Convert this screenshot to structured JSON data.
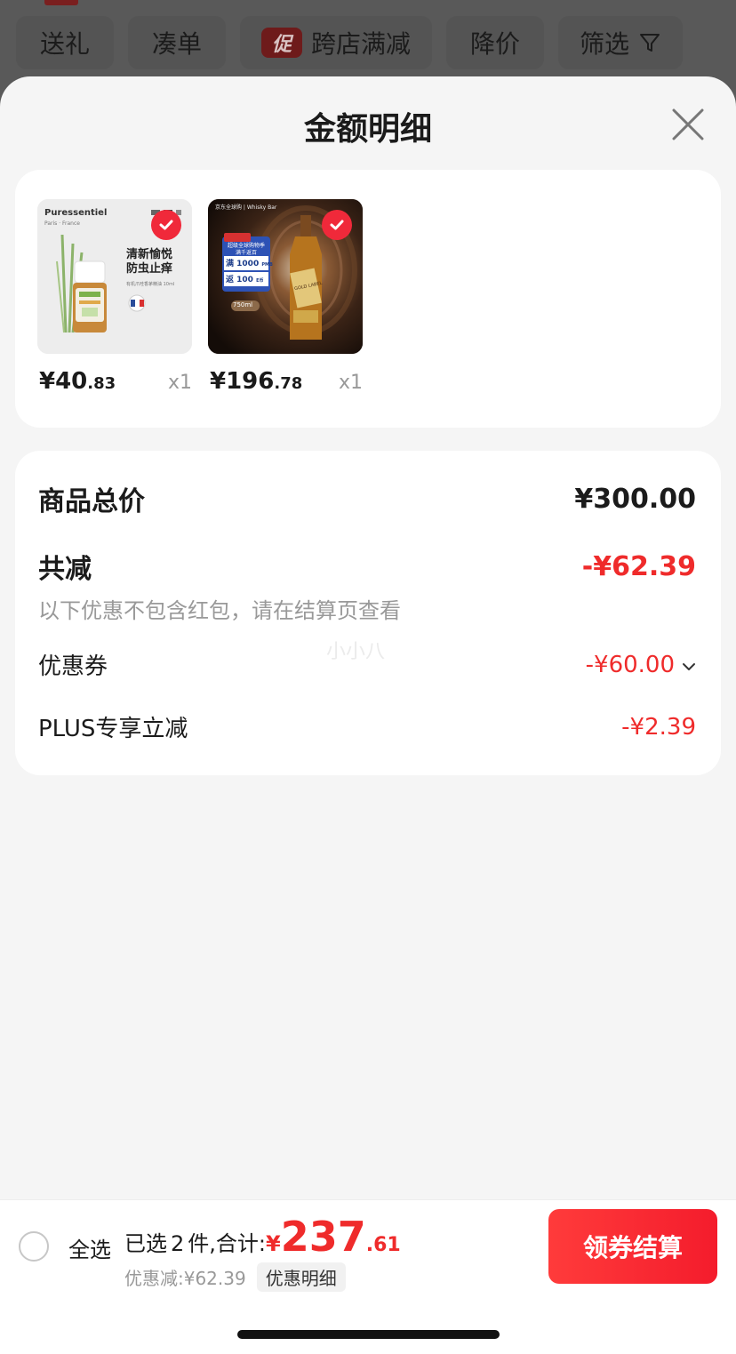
{
  "filter_bar": {
    "chips": [
      "送礼",
      "凑单",
      "跨店满减",
      "降价",
      "筛选"
    ],
    "promo_badge": "促"
  },
  "sheet": {
    "title": "金额明细"
  },
  "products": [
    {
      "price_int": "¥40",
      "price_dec": ".83",
      "qty": "x1",
      "image": {
        "brand": "Puressentiel",
        "brand_sub": "Paris · France",
        "tagline_1": "清新愉悦",
        "tagline_2": "防虫止痒",
        "desc": "有机爪哇香茅精油 10ml"
      }
    },
    {
      "price_int": "¥196",
      "price_dec": ".78",
      "qty": "x1",
      "image": {
        "header": "京东全球购 | Whisky Bar",
        "promo_title": "超级全球购物季",
        "promo_sub": "满千返百",
        "row1_label": "满",
        "row1_amt": "1000",
        "row1_unit": "PMB",
        "row2_label": "返",
        "row2_amt": "100",
        "row2_unit": "E币",
        "volume": "750ml",
        "label_text": "GOLD LABEL"
      }
    }
  ],
  "summary": {
    "total_label": "商品总价",
    "total_value": "¥300.00",
    "reduce_label": "共减",
    "reduce_value": "-¥62.39",
    "note": "以下优惠不包含红包，请在结算页查看",
    "coupon_label": "优惠券",
    "coupon_value": "-¥60.00",
    "plus_label": "PLUS专享立减",
    "plus_value": "-¥2.39",
    "watermark": "小小八"
  },
  "checkout": {
    "select_all": "全选",
    "selected_prefix": "已选",
    "selected_count": "2",
    "selected_suffix": "件,合计:",
    "currency": "¥",
    "total_int": "237",
    "total_dec": ".61",
    "discount_text": "优惠减:¥62.39",
    "detail_button": "优惠明细",
    "checkout_button": "领券结算"
  },
  "colors": {
    "accent_red": "#ef2b2b",
    "check_red": "#f0293a",
    "sheet_bg": "#f5f5f5",
    "overlay": "#595959"
  }
}
